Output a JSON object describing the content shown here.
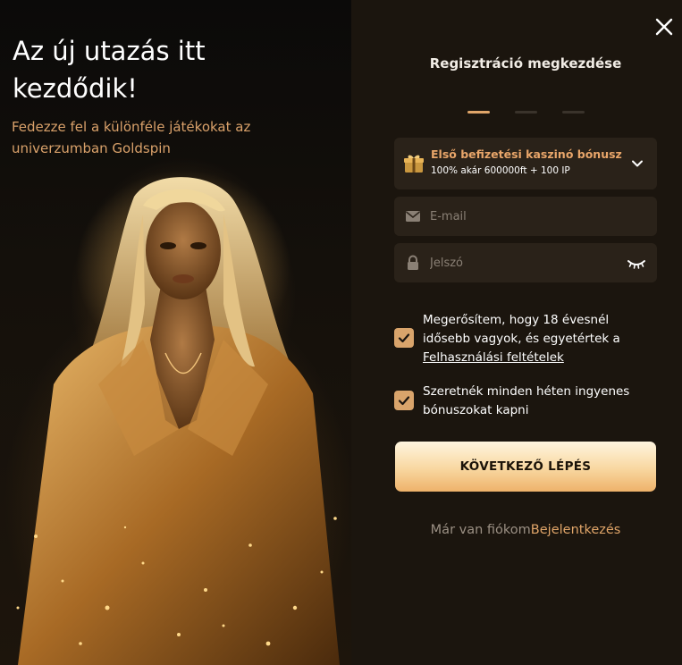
{
  "promo": {
    "title": "Az új utazás itt kezdődik!",
    "subtitle": "Fedezze fel a különféle játékokat az univerzumban Goldspin"
  },
  "form": {
    "title": "Regisztráció megkezdése",
    "steps_total": 3,
    "step_active": 1,
    "bonus": {
      "title": "Első befizetési kaszinó bónusz",
      "description": "100% akár 600000ft + 100 IP"
    },
    "email_placeholder": "E-mail",
    "password_placeholder": "Jelszó",
    "age_confirm": {
      "text": "Megerősítem, hogy 18 évesnél idősebb vagyok, és egyetértek a",
      "link": "Felhasználási feltételek",
      "checked": true
    },
    "weekly_bonus": {
      "text": "Szeretnék minden héten ingyenes bónuszokat kapni",
      "checked": true
    },
    "next_button": "KÖVETKEZŐ LÉPÉS",
    "login_prefix": "Már van fiókom",
    "login_link": "Bejelentkezés"
  },
  "colors": {
    "accent": "#e0a569",
    "panel_bg": "#1b150e",
    "field_bg": "#2a2219",
    "checkbox": "#d9a46b"
  },
  "icons": [
    "close-icon",
    "gift-icon",
    "chevron-down-icon",
    "mail-icon",
    "lock-icon",
    "eye-closed-icon",
    "check-icon"
  ]
}
